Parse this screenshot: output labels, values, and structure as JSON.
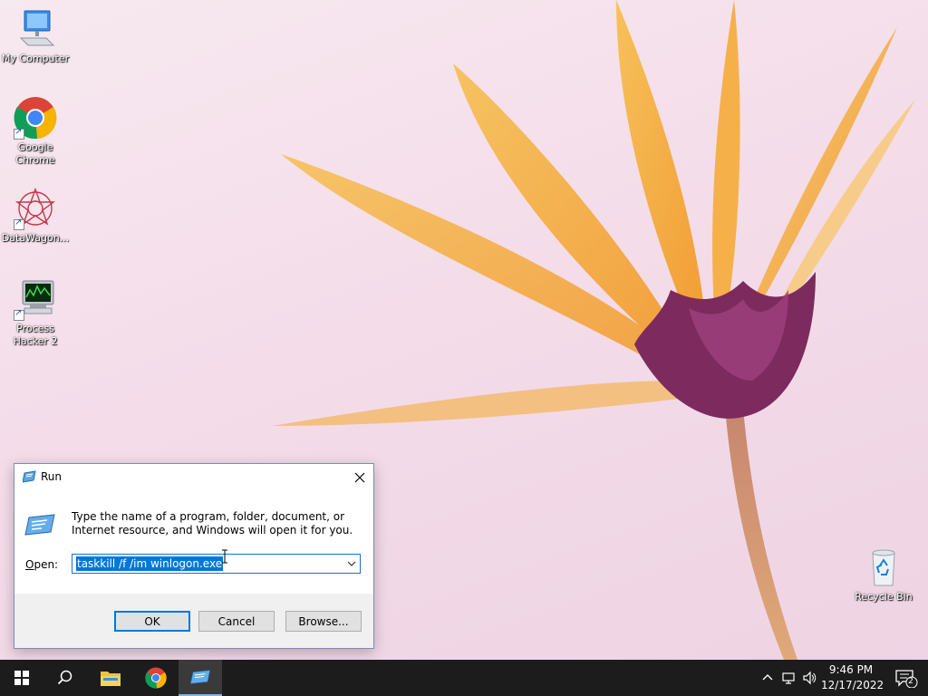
{
  "desktop": {
    "icons": [
      {
        "label": "My Computer"
      },
      {
        "label": "Google Chrome"
      },
      {
        "label": "DataWagon..."
      },
      {
        "label": "Process Hacker 2"
      },
      {
        "label": "Recycle Bin"
      }
    ]
  },
  "run_dialog": {
    "title": "Run",
    "description": "Type the name of a program, folder, document, or Internet resource, and Windows will open it for you.",
    "open_label_accel": "O",
    "open_label_rest": "pen:",
    "open_value": "taskkill /f /im winlogon.exe",
    "ok_label": "OK",
    "cancel_label": "Cancel",
    "browse_label": "Browse..."
  },
  "taskbar": {
    "time": "9:46 PM",
    "date": "12/17/2022",
    "notification_count": "2"
  },
  "colors": {
    "accent": "#0078d7",
    "taskbar": "#1c1c1c"
  }
}
